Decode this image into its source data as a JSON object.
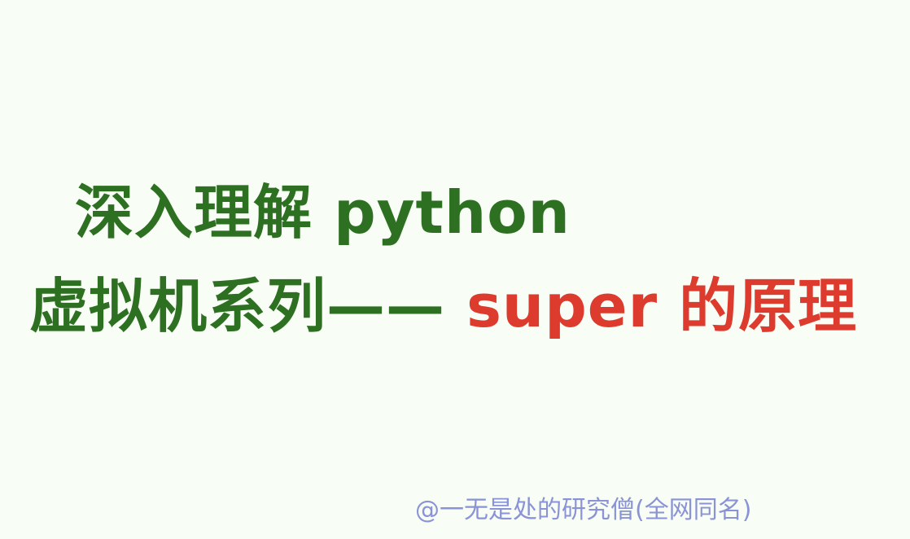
{
  "title": {
    "line1": "深入理解 python",
    "line2_prefix": "虚拟机系列—— ",
    "line2_highlight": "super 的原理"
  },
  "watermark": "@一无是处的研究僧(全网同名)",
  "colors": {
    "background": "#f8fdf6",
    "title_green": "#2e7021",
    "title_red": "#dc3b2e",
    "watermark": "#8a93d6"
  }
}
